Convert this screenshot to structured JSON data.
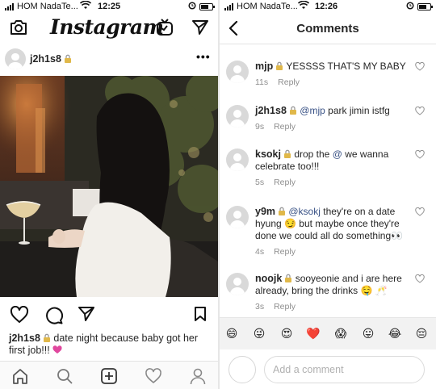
{
  "left_screen": {
    "status": {
      "carrier": "HOM NadaTe...",
      "time": "12:25"
    },
    "header": {
      "logo": "Instagram"
    },
    "post": {
      "username": "j2h1s8",
      "caption_username": "j2h1s8",
      "caption_text": "date night because baby got her first job!!!"
    },
    "icons": {
      "camera": "camera-icon",
      "igtv": "igtv-icon",
      "direct": "paper-plane-icon",
      "more": "more-icon",
      "like": "heart-icon",
      "comment": "comment-icon",
      "share": "share-icon",
      "save": "bookmark-icon"
    },
    "tabbar": [
      "home",
      "search",
      "new-post",
      "activity",
      "profile"
    ]
  },
  "right_screen": {
    "status": {
      "carrier": "HOM NadaTe...",
      "time": "12:26"
    },
    "header": {
      "title": "Comments"
    },
    "comments": [
      {
        "user": "mjp",
        "mention": "",
        "text": "YESSSS THAT'S MY BABY",
        "time": "11s",
        "reply": "Reply"
      },
      {
        "user": "j2h1s8",
        "mention": "@mjp",
        "text": "park jimin istfg",
        "time": "9s",
        "reply": "Reply"
      },
      {
        "user": "ksokj",
        "text_before": "drop the",
        "mention": "@",
        "text": "we wanna celebrate too!!!",
        "time": "5s",
        "reply": "Reply"
      },
      {
        "user": "y9m",
        "mention": "@ksokj",
        "text": "they're on a date hyung 😏 but maybe once they're done we could all do something👀",
        "time": "4s",
        "reply": "Reply"
      },
      {
        "user": "noojk",
        "mention": "",
        "text": "sooyeonie and i are here already, bring the drinks 🤤 🥂",
        "time": "3s",
        "reply": "Reply"
      }
    ],
    "emoji_bar": [
      "😄",
      "😜",
      "😍",
      "❤️",
      "😱",
      "😛",
      "😂",
      "😔"
    ],
    "add_comment": {
      "placeholder": "Add a comment"
    }
  },
  "colors": {
    "text": "#262626",
    "mention": "#385185",
    "meta": "#8e8e8e",
    "heart_pink": "#e0479e",
    "heart_red": "#ed1b2e"
  }
}
